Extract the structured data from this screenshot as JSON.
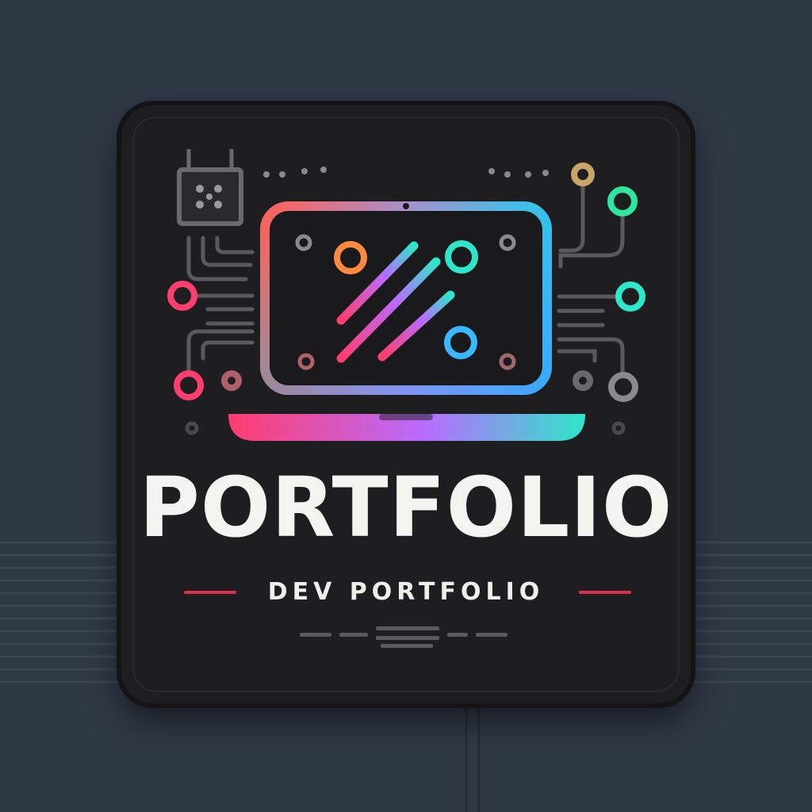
{
  "logo": {
    "title": "PORTFOLIO",
    "subtitle": "DEV PORTFOLIO",
    "icon": "laptop-circuit-icon"
  },
  "colors": {
    "background": "#2f3845",
    "badge": "#1e1e20",
    "accent_red": "#e0304f",
    "gradient_pink": "#ff3d6e",
    "gradient_orange": "#ff8a3d",
    "gradient_teal": "#2ee6c9",
    "gradient_blue": "#3aa8ff",
    "text": "#f3f3ef"
  }
}
